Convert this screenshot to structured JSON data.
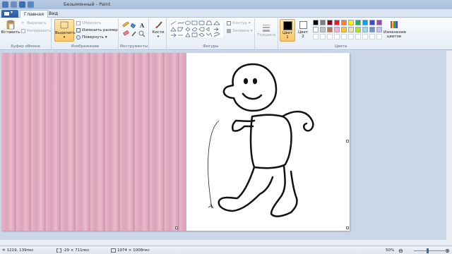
{
  "window": {
    "title": "Безымянный - Paint"
  },
  "tabs": [
    {
      "label": "Главная"
    },
    {
      "label": "Вид"
    }
  ],
  "clipboard": {
    "paste": "Вставить",
    "cut": "Вырезать",
    "copy": "Копировать",
    "group": "Буфер обмена"
  },
  "image": {
    "select": "Выделить",
    "crop": "Обрезать",
    "resize": "Изменить размер",
    "rotate": "Повернуть",
    "group": "Изображение"
  },
  "tools": {
    "group": "Инструменты"
  },
  "brushes": {
    "label": "Кисти"
  },
  "shapes": {
    "outline": "Контур",
    "fill": "Заливка",
    "group": "Фигуры"
  },
  "size": {
    "label": "Толщина"
  },
  "colors": {
    "color1": "Цвет\n1",
    "color2": "Цвет\n2",
    "edit": "Изменение цветов",
    "group": "Цвета",
    "color1_value": "#000000",
    "color2_value": "#ffffff",
    "palette_row1": [
      "#000000",
      "#7f7f7f",
      "#880015",
      "#ed1c24",
      "#ff7f27",
      "#fff200",
      "#22b14c",
      "#00a2e8",
      "#3f48cc",
      "#a349a4"
    ],
    "palette_row2": [
      "#ffffff",
      "#c3c3c3",
      "#b97a57",
      "#ffaec9",
      "#ffc90e",
      "#efe4b0",
      "#b5e61d",
      "#99d9ea",
      "#7092be",
      "#c8bfe7"
    ]
  },
  "status": {
    "cursor_pos": "1219, 139пкс",
    "selection_size": "-29 × 711пкс",
    "image_size": "1974 × 1008пкс",
    "zoom": "50%"
  }
}
